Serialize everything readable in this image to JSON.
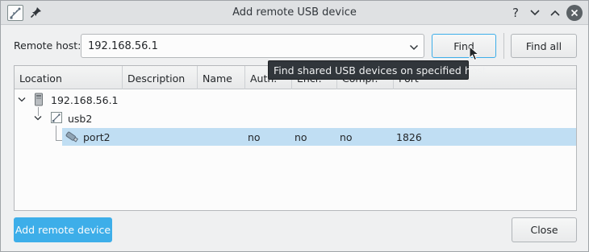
{
  "window": {
    "title": "Add remote USB device",
    "help_label": "?"
  },
  "host": {
    "label": "Remote host:",
    "value": "192.168.56.1"
  },
  "buttons": {
    "find": "Find",
    "find_all": "Find all",
    "add_remote": "Add remote device",
    "close": "Close"
  },
  "tooltip": "Find shared USB devices on specified host",
  "tree": {
    "columns": [
      "Location",
      "Description",
      "Name",
      "Auth.",
      "Encr.",
      "Compr.",
      "Port"
    ],
    "nodes": [
      {
        "location": "192.168.56.1",
        "icon": "computer-icon"
      },
      {
        "location": "usb2",
        "icon": "usb-hub-icon"
      },
      {
        "location": "port2",
        "icon": "usb-plug-icon",
        "auth": "no",
        "encr": "no",
        "compr": "no",
        "port": "1826",
        "selected": true
      }
    ]
  },
  "colors": {
    "accent": "#3daee9",
    "selection": "#c0def3",
    "tooltip_bg": "#31363b"
  }
}
